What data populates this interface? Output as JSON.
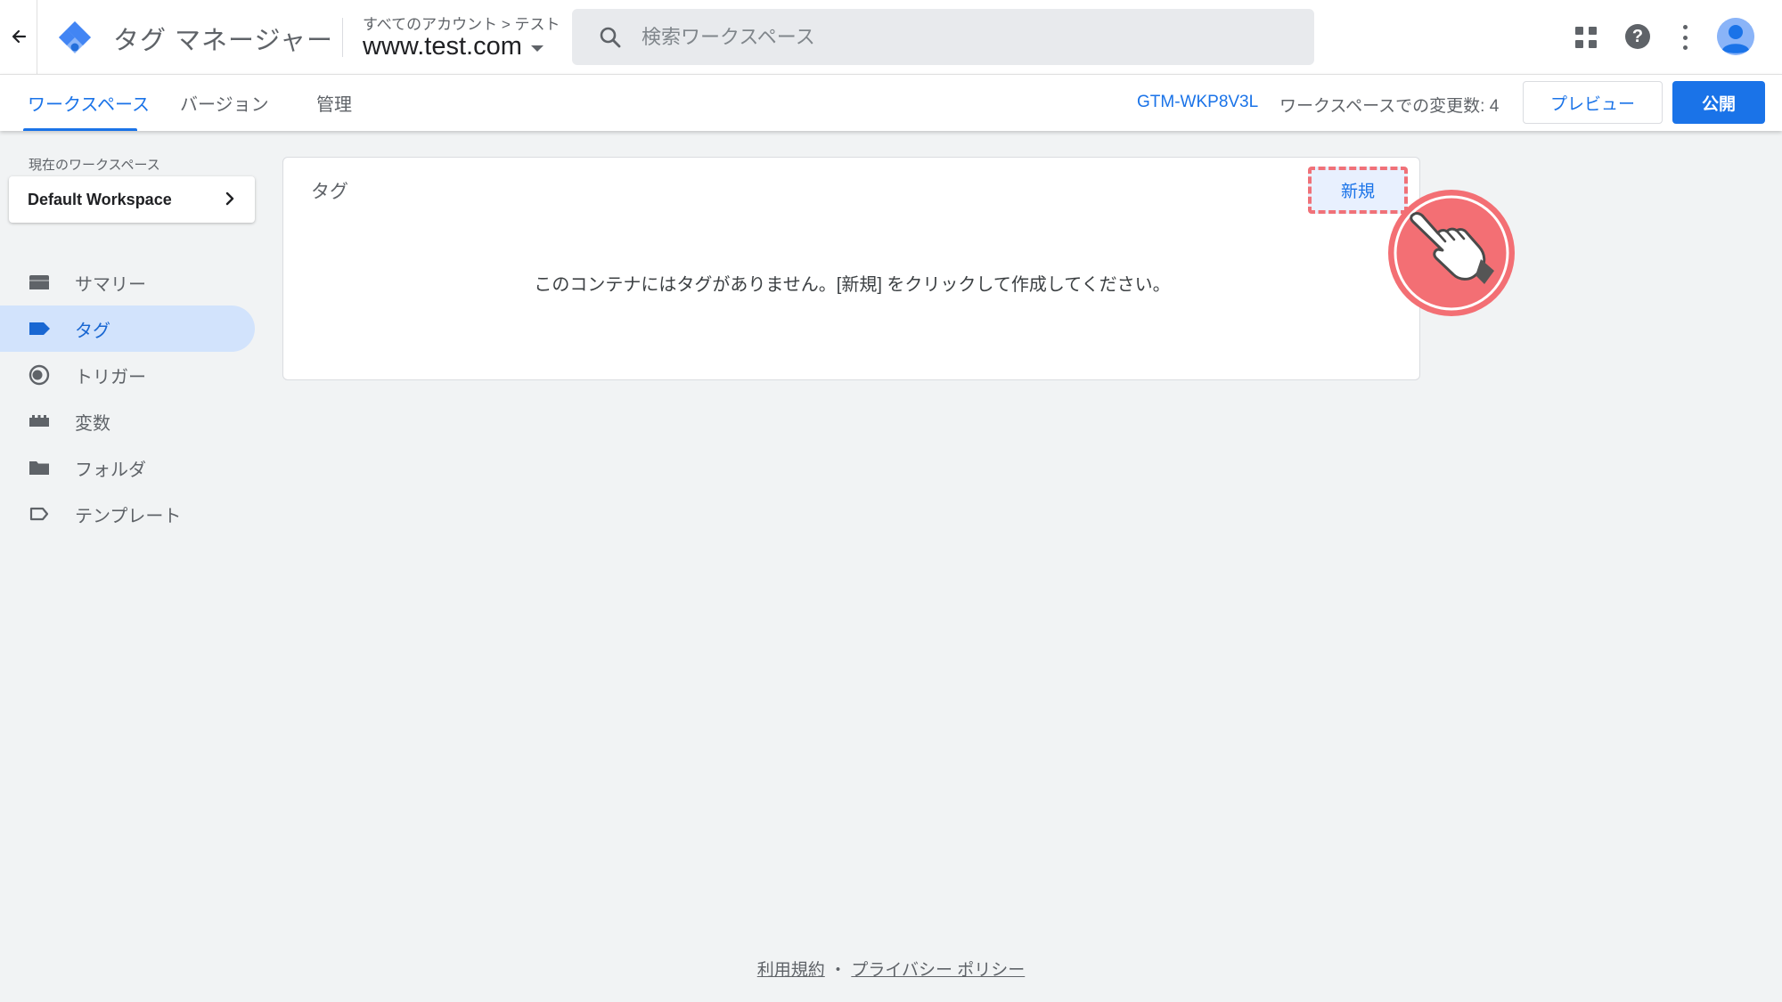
{
  "header": {
    "app_title": "タグ マネージャー",
    "breadcrumb": "すべてのアカウント > テスト",
    "container_name": "www.test.com",
    "search_placeholder": "検索ワークスペース"
  },
  "tabs": [
    {
      "label": "ワークスペース",
      "active": true
    },
    {
      "label": "バージョン",
      "active": false
    },
    {
      "label": "管理",
      "active": false
    }
  ],
  "status": {
    "container_id": "GTM-WKP8V3L",
    "workspace_changes": "ワークスペースでの変更数: 4"
  },
  "actions": {
    "preview_label": "プレビュー",
    "publish_label": "公開"
  },
  "sidebar": {
    "workspace_label": "現在のワークスペース",
    "workspace_name": "Default Workspace",
    "items": [
      {
        "label": "サマリー",
        "icon": "summary-icon",
        "active": false
      },
      {
        "label": "タグ",
        "icon": "tag-icon",
        "active": true
      },
      {
        "label": "トリガー",
        "icon": "trigger-icon",
        "active": false
      },
      {
        "label": "変数",
        "icon": "variables-icon",
        "active": false
      },
      {
        "label": "フォルダ",
        "icon": "folder-icon",
        "active": false
      },
      {
        "label": "テンプレート",
        "icon": "template-icon",
        "active": false
      }
    ]
  },
  "main": {
    "card_title": "タグ",
    "new_button_label": "新規",
    "empty_message": "このコンテナにはタグがありません。[新規] をクリックして作成してください。"
  },
  "footer": {
    "terms": "利用規約",
    "separator": "・",
    "privacy": "プライバシー ポリシー"
  },
  "colors": {
    "accent": "#1a73e8",
    "active_nav_bg": "#d2e3fc",
    "highlight_annotation": "#f07178"
  }
}
